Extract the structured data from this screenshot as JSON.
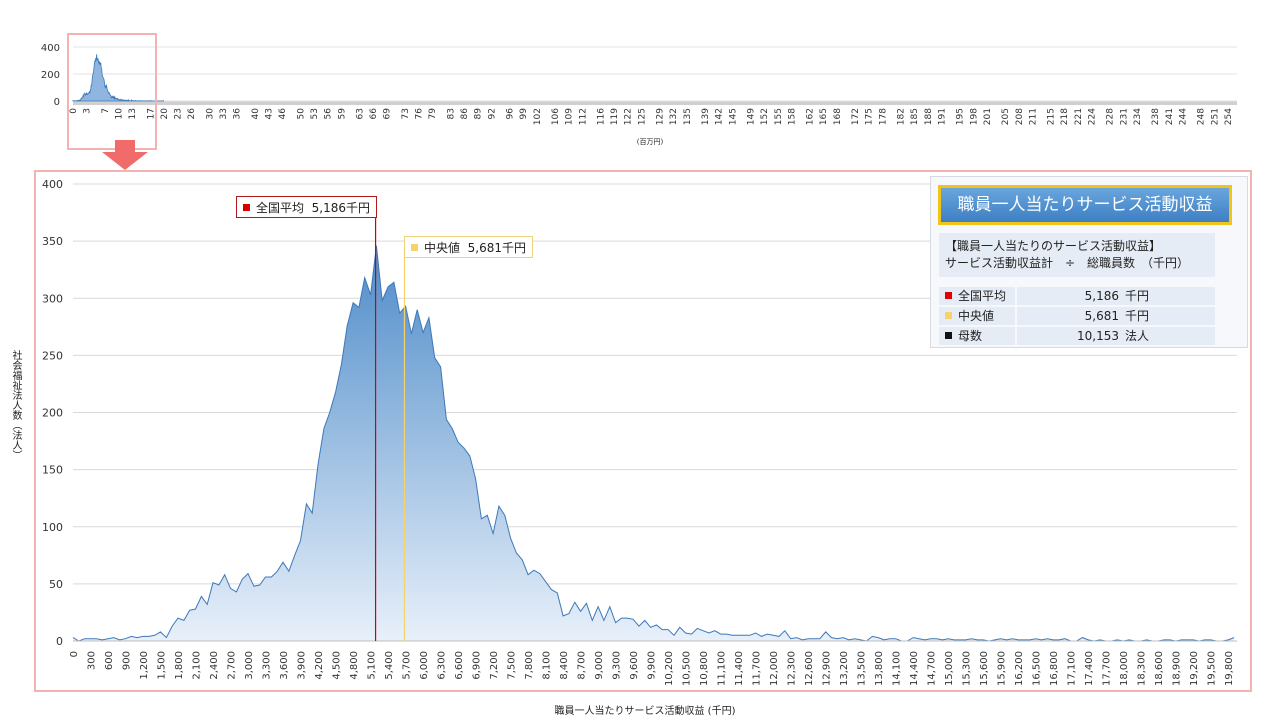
{
  "overview": {
    "xlabel": "(百万円)",
    "y_ticks": [
      0,
      200,
      400
    ],
    "x_ticks": [
      "0",
      "3",
      "7",
      "10",
      "13",
      "17",
      "20",
      "23",
      "26",
      "30",
      "33",
      "36",
      "40",
      "43",
      "46",
      "50",
      "53",
      "56",
      "59",
      "63",
      "66",
      "69",
      "73",
      "76",
      "79",
      "83",
      "86",
      "89",
      "92",
      "96",
      "99",
      "102",
      "106",
      "109",
      "112",
      "116",
      "119",
      "122",
      "125",
      "129",
      "132",
      "135",
      "139",
      "142",
      "145",
      "149",
      "152",
      "155",
      "158",
      "162",
      "165",
      "168",
      "172",
      "175",
      "178",
      "182",
      "185",
      "188",
      "191",
      "195",
      "198",
      "201",
      "205",
      "208",
      "211",
      "215",
      "218",
      "221",
      "224",
      "228",
      "231",
      "234",
      "238",
      "241",
      "244",
      "248",
      "251",
      "254"
    ]
  },
  "chart_data": {
    "type": "area",
    "xlabel": "職員一人当たりサービス活動収益 (千円)",
    "ylabel": "社会福祉法人数（法人）",
    "ylim": [
      0,
      400
    ],
    "y_ticks": [
      0,
      50,
      100,
      150,
      200,
      250,
      300,
      350,
      400
    ],
    "xlim": [
      0,
      19950
    ],
    "x_ticks": [
      0,
      300,
      600,
      900,
      1200,
      1500,
      1800,
      2100,
      2400,
      2700,
      3000,
      3300,
      3600,
      3900,
      4200,
      4500,
      4800,
      5100,
      5400,
      5700,
      6000,
      6300,
      6600,
      6900,
      7200,
      7500,
      7800,
      8100,
      8400,
      8700,
      9000,
      9300,
      9600,
      9900,
      10200,
      10500,
      10800,
      11100,
      11400,
      11700,
      12000,
      12300,
      12600,
      12900,
      13200,
      13500,
      13800,
      14100,
      14400,
      14700,
      15000,
      15300,
      15600,
      15900,
      16200,
      16500,
      16800,
      17100,
      17400,
      17700,
      18000,
      18300,
      18600,
      18900,
      19200,
      19500,
      19800
    ],
    "x_tick_labels": [
      "0",
      "300",
      "600",
      "900",
      "1,200",
      "1,500",
      "1,800",
      "2,100",
      "2,400",
      "2,700",
      "3,000",
      "3,300",
      "3,600",
      "3,900",
      "4,200",
      "4,500",
      "4,800",
      "5,100",
      "5,400",
      "5,700",
      "6,000",
      "6,300",
      "6,600",
      "6,900",
      "7,200",
      "7,500",
      "7,800",
      "8,100",
      "8,400",
      "8,700",
      "9,000",
      "9,300",
      "9,600",
      "9,900",
      "10,200",
      "10,500",
      "10,800",
      "11,100",
      "11,400",
      "11,700",
      "12,000",
      "12,300",
      "12,600",
      "12,900",
      "13,200",
      "13,500",
      "13,800",
      "14,100",
      "14,400",
      "14,700",
      "15,000",
      "15,300",
      "15,600",
      "15,900",
      "16,200",
      "16,500",
      "16,800",
      "17,100",
      "17,400",
      "17,700",
      "18,000",
      "18,300",
      "18,600",
      "18,900",
      "19,200",
      "19,500",
      "19,800"
    ],
    "series": [
      {
        "values": [
          [
            0,
            3
          ],
          [
            100,
            0
          ],
          [
            200,
            2
          ],
          [
            300,
            2
          ],
          [
            400,
            2
          ],
          [
            500,
            1
          ],
          [
            600,
            2
          ],
          [
            700,
            3
          ],
          [
            800,
            1
          ],
          [
            900,
            2
          ],
          [
            1000,
            4
          ],
          [
            1100,
            3
          ],
          [
            1200,
            4
          ],
          [
            1300,
            4
          ],
          [
            1400,
            5
          ],
          [
            1500,
            8
          ],
          [
            1600,
            3
          ],
          [
            1700,
            13
          ],
          [
            1800,
            20
          ],
          [
            1900,
            18
          ],
          [
            2000,
            27
          ],
          [
            2100,
            28
          ],
          [
            2200,
            39
          ],
          [
            2300,
            32
          ],
          [
            2400,
            51
          ],
          [
            2500,
            49
          ],
          [
            2600,
            58
          ],
          [
            2700,
            46
          ],
          [
            2800,
            43
          ],
          [
            2900,
            54
          ],
          [
            3000,
            59
          ],
          [
            3100,
            48
          ],
          [
            3200,
            49
          ],
          [
            3300,
            56
          ],
          [
            3400,
            56
          ],
          [
            3500,
            61
          ],
          [
            3600,
            69
          ],
          [
            3700,
            61
          ],
          [
            3800,
            75
          ],
          [
            3900,
            88
          ],
          [
            4000,
            120
          ],
          [
            4100,
            112
          ],
          [
            4200,
            155
          ],
          [
            4300,
            186
          ],
          [
            4400,
            200
          ],
          [
            4500,
            218
          ],
          [
            4600,
            242
          ],
          [
            4700,
            276
          ],
          [
            4800,
            296
          ],
          [
            4900,
            292
          ],
          [
            5000,
            318
          ],
          [
            5100,
            303
          ],
          [
            5200,
            346
          ],
          [
            5300,
            298
          ],
          [
            5400,
            310
          ],
          [
            5500,
            314
          ],
          [
            5600,
            287
          ],
          [
            5700,
            293
          ],
          [
            5800,
            269
          ],
          [
            5900,
            290
          ],
          [
            6000,
            270
          ],
          [
            6100,
            283
          ],
          [
            6200,
            248
          ],
          [
            6300,
            240
          ],
          [
            6400,
            194
          ],
          [
            6500,
            186
          ],
          [
            6600,
            174
          ],
          [
            6700,
            169
          ],
          [
            6800,
            162
          ],
          [
            6900,
            142
          ],
          [
            7000,
            107
          ],
          [
            7100,
            110
          ],
          [
            7200,
            94
          ],
          [
            7300,
            118
          ],
          [
            7400,
            110
          ],
          [
            7500,
            90
          ],
          [
            7600,
            77
          ],
          [
            7700,
            71
          ],
          [
            7800,
            58
          ],
          [
            7900,
            62
          ],
          [
            8000,
            59
          ],
          [
            8100,
            52
          ],
          [
            8200,
            45
          ],
          [
            8300,
            42
          ],
          [
            8400,
            22
          ],
          [
            8500,
            24
          ],
          [
            8600,
            34
          ],
          [
            8700,
            26
          ],
          [
            8800,
            33
          ],
          [
            8900,
            18
          ],
          [
            9000,
            30
          ],
          [
            9100,
            18
          ],
          [
            9200,
            30
          ],
          [
            9300,
            16
          ],
          [
            9400,
            20
          ],
          [
            9500,
            20
          ],
          [
            9600,
            19
          ],
          [
            9700,
            13
          ],
          [
            9800,
            18
          ],
          [
            9900,
            12
          ],
          [
            10000,
            14
          ],
          [
            10100,
            10
          ],
          [
            10200,
            10
          ],
          [
            10300,
            5
          ],
          [
            10400,
            12
          ],
          [
            10500,
            7
          ],
          [
            10600,
            6
          ],
          [
            10700,
            11
          ],
          [
            10800,
            9
          ],
          [
            10900,
            7
          ],
          [
            11000,
            9
          ],
          [
            11100,
            6
          ],
          [
            11200,
            6
          ],
          [
            11300,
            5
          ],
          [
            11400,
            5
          ],
          [
            11500,
            5
          ],
          [
            11600,
            5
          ],
          [
            11700,
            7
          ],
          [
            11800,
            4
          ],
          [
            11900,
            6
          ],
          [
            12000,
            5
          ],
          [
            12100,
            4
          ],
          [
            12200,
            9
          ],
          [
            12300,
            2
          ],
          [
            12400,
            3
          ],
          [
            12500,
            1
          ],
          [
            12600,
            2
          ],
          [
            12700,
            2
          ],
          [
            12800,
            2
          ],
          [
            12900,
            8
          ],
          [
            13000,
            3
          ],
          [
            13100,
            2
          ],
          [
            13200,
            3
          ],
          [
            13300,
            1
          ],
          [
            13400,
            2
          ],
          [
            13500,
            1
          ],
          [
            13600,
            0
          ],
          [
            13700,
            4
          ],
          [
            13800,
            3
          ],
          [
            13900,
            1
          ],
          [
            14000,
            2
          ],
          [
            14100,
            2
          ],
          [
            14200,
            0
          ],
          [
            14300,
            0
          ],
          [
            14400,
            3
          ],
          [
            14500,
            2
          ],
          [
            14600,
            1
          ],
          [
            14700,
            2
          ],
          [
            14800,
            2
          ],
          [
            14900,
            1
          ],
          [
            15000,
            2
          ],
          [
            15100,
            1
          ],
          [
            15200,
            1
          ],
          [
            15300,
            1
          ],
          [
            15400,
            2
          ],
          [
            15500,
            1
          ],
          [
            15600,
            1
          ],
          [
            15700,
            0
          ],
          [
            15800,
            1
          ],
          [
            15900,
            2
          ],
          [
            16000,
            1
          ],
          [
            16100,
            2
          ],
          [
            16200,
            1
          ],
          [
            16300,
            1
          ],
          [
            16400,
            1
          ],
          [
            16500,
            2
          ],
          [
            16600,
            1
          ],
          [
            16700,
            2
          ],
          [
            16800,
            1
          ],
          [
            16900,
            1
          ],
          [
            17000,
            2
          ],
          [
            17100,
            0
          ],
          [
            17200,
            0
          ],
          [
            17300,
            3
          ],
          [
            17400,
            1
          ],
          [
            17500,
            0
          ],
          [
            17600,
            1
          ],
          [
            17700,
            0
          ],
          [
            17800,
            0
          ],
          [
            17900,
            1
          ],
          [
            18000,
            0
          ],
          [
            18100,
            1
          ],
          [
            18200,
            0
          ],
          [
            18300,
            0
          ],
          [
            18400,
            1
          ],
          [
            18500,
            0
          ],
          [
            18600,
            0
          ],
          [
            18700,
            1
          ],
          [
            18800,
            1
          ],
          [
            18900,
            0
          ],
          [
            19000,
            1
          ],
          [
            19100,
            1
          ],
          [
            19200,
            1
          ],
          [
            19300,
            0
          ],
          [
            19400,
            1
          ],
          [
            19500,
            1
          ],
          [
            19600,
            0
          ],
          [
            19700,
            0
          ],
          [
            19800,
            1
          ],
          [
            19900,
            3
          ]
        ]
      }
    ],
    "markers": [
      {
        "label": "全国平均",
        "value_text": "5,186千円",
        "x": 5186,
        "color": "#d40000"
      },
      {
        "label": "中央値",
        "value_text": "5,681千円",
        "x": 5681,
        "color": "#f5d36a"
      }
    ],
    "grid": true,
    "colors": {
      "line": "#3d78b8",
      "fill_top": "#4f8cc9",
      "fill_bottom": "#e8f0fa"
    }
  },
  "info_panel": {
    "title": "職員一人当たりサービス活動収益",
    "formula_line1": "【職員一人当たりのサービス活動収益】",
    "formula_line2": "サービス活動収益計　÷　総職員数　（千円）",
    "rows": [
      {
        "label": "全国平均",
        "value": "5,186",
        "unit": "千円",
        "color": "#e00000"
      },
      {
        "label": "中央値",
        "value": "5,681",
        "unit": "千円",
        "color": "#f5d36a"
      },
      {
        "label": "母数",
        "value": "10,153",
        "unit": "法人",
        "color": "#111111"
      }
    ]
  }
}
